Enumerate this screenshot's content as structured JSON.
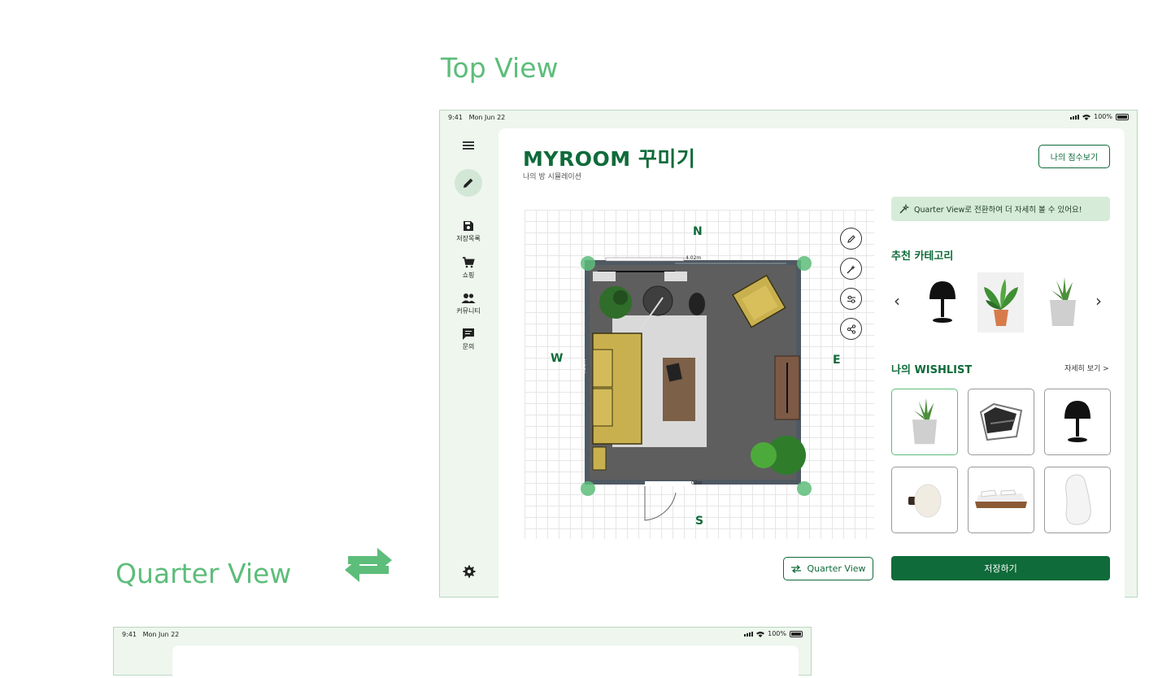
{
  "labels": {
    "top_view": "Top View",
    "quarter_view": "Quarter View"
  },
  "status": {
    "time": "9:41",
    "date": "Mon Jun 22",
    "battery": "100%"
  },
  "sidebar": {
    "items": [
      {
        "label": "저장목록",
        "icon": "save-icon"
      },
      {
        "label": "쇼핑",
        "icon": "cart-icon"
      },
      {
        "label": "커뮤니티",
        "icon": "people-icon"
      },
      {
        "label": "문의",
        "icon": "chat-icon"
      }
    ]
  },
  "header": {
    "title": "MYROOM 꾸미기",
    "subtitle": "나의 방 시뮬레이션",
    "score_button": "나의 점수보기"
  },
  "plan": {
    "compass": {
      "north": "N",
      "south": "S",
      "east": "E",
      "west": "W"
    },
    "dimension_top": "4.02m",
    "dimension_side": "4.21m",
    "dimension_bottom": "02m"
  },
  "tip_banner": "Quarter View로 전환하여 더 자세히 볼 수 있어요!",
  "recommend": {
    "title": "추천 카테고리",
    "items": [
      "lamp",
      "plant",
      "pot"
    ]
  },
  "wishlist": {
    "title": "나의 WISHLIST",
    "more": "자세히 보기 >",
    "items": [
      "pot",
      "chair",
      "lamp",
      "wall-lamp",
      "bed",
      "mirror"
    ]
  },
  "buttons": {
    "quarter_view": "Quarter View",
    "save": "저장하기"
  },
  "colors": {
    "brand_green": "#0f6b3a",
    "accent_green": "#5dbd7a",
    "sidebar_bg": "#eef6ee"
  }
}
